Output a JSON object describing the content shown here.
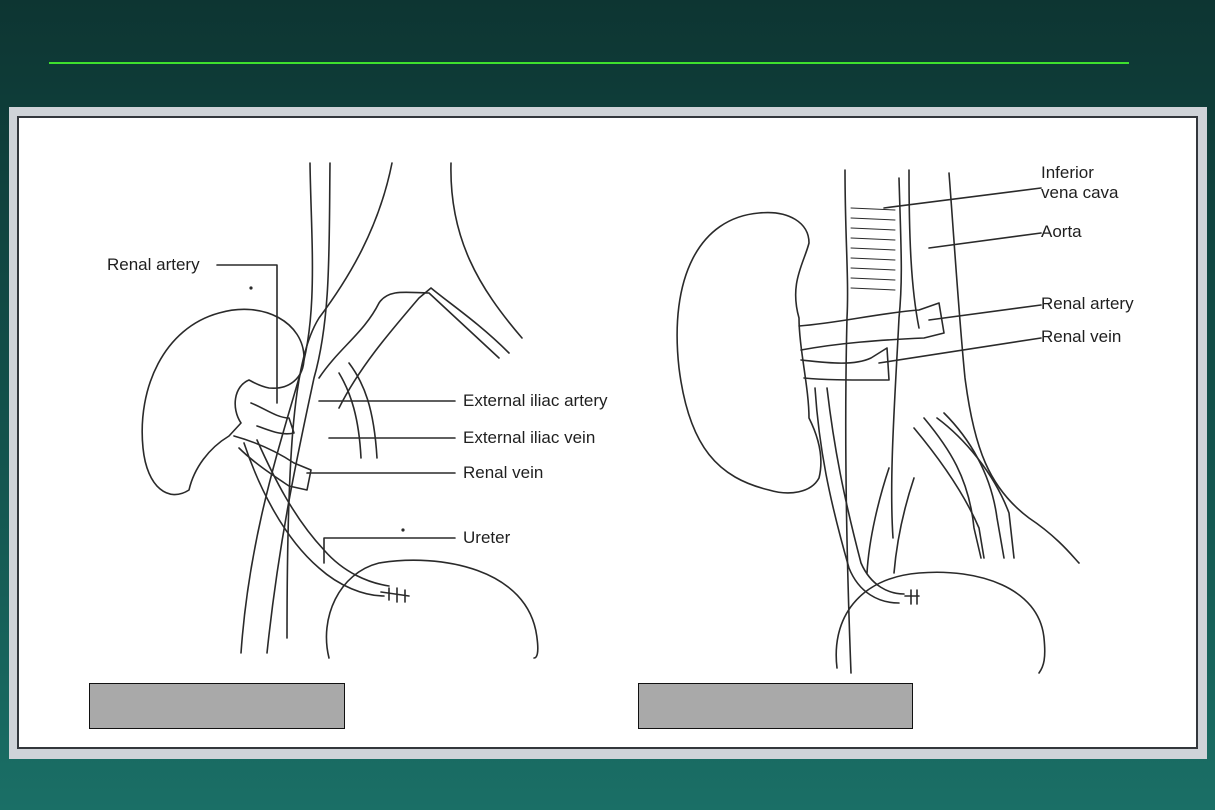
{
  "left_figure": {
    "labels": {
      "renal_artery": "Renal artery",
      "external_iliac_artery": "External iliac artery",
      "external_iliac_vein": "External iliac vein",
      "renal_vein": "Renal vein",
      "ureter": "Ureter"
    }
  },
  "right_figure": {
    "labels": {
      "inferior_vena_cava": "Inferior\nvena cava",
      "aorta": "Aorta",
      "renal_artery": "Renal artery",
      "renal_vein": "Renal vein"
    }
  },
  "colors": {
    "background_top": "#0d3532",
    "background_bottom": "#1a6f66",
    "title_rule": "#3ee02e",
    "caption_box": "#a9a9a9"
  }
}
